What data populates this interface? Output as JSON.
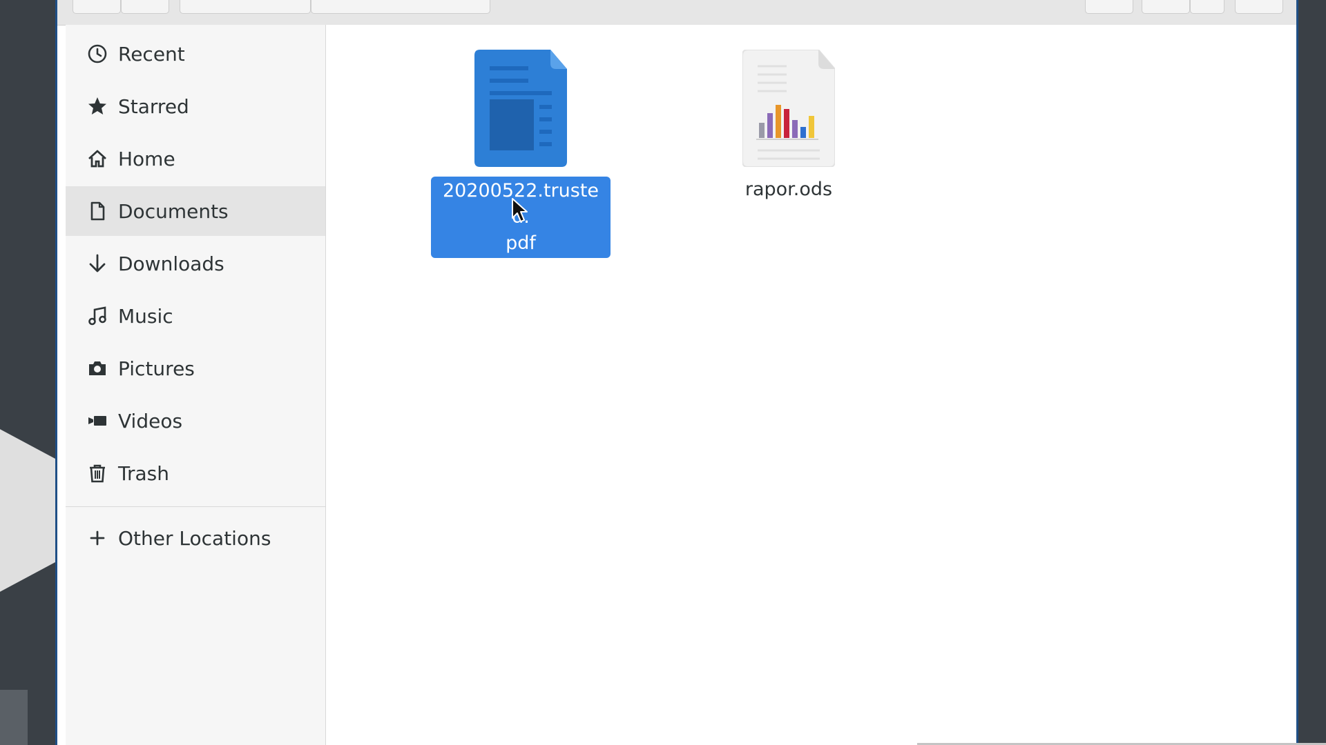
{
  "sidebar": {
    "items": [
      {
        "label": "Recent",
        "icon": "clock-icon"
      },
      {
        "label": "Starred",
        "icon": "star-icon"
      },
      {
        "label": "Home",
        "icon": "home-icon"
      },
      {
        "label": "Documents",
        "icon": "document-icon",
        "active": true
      },
      {
        "label": "Downloads",
        "icon": "download-arrow-icon"
      },
      {
        "label": "Music",
        "icon": "music-note-icon"
      },
      {
        "label": "Pictures",
        "icon": "camera-icon"
      },
      {
        "label": "Videos",
        "icon": "video-camera-icon"
      },
      {
        "label": "Trash",
        "icon": "trash-icon"
      }
    ],
    "other_locations": {
      "label": "Other Locations",
      "icon": "plus-icon"
    }
  },
  "files": [
    {
      "name": "20200522.trusted.pdf",
      "name_line1": "20200522.trusted.",
      "name_line2": "pdf",
      "type": "pdf",
      "selected": true,
      "icon": "pdf-document-icon"
    },
    {
      "name": "rapor.ods",
      "type": "spreadsheet",
      "selected": false,
      "icon": "spreadsheet-icon"
    }
  ],
  "colors": {
    "selection": "#3584e4",
    "sidebar_bg": "#f6f6f6",
    "sidebar_active": "#e4e4e4",
    "window_border": "#1f4f86"
  }
}
